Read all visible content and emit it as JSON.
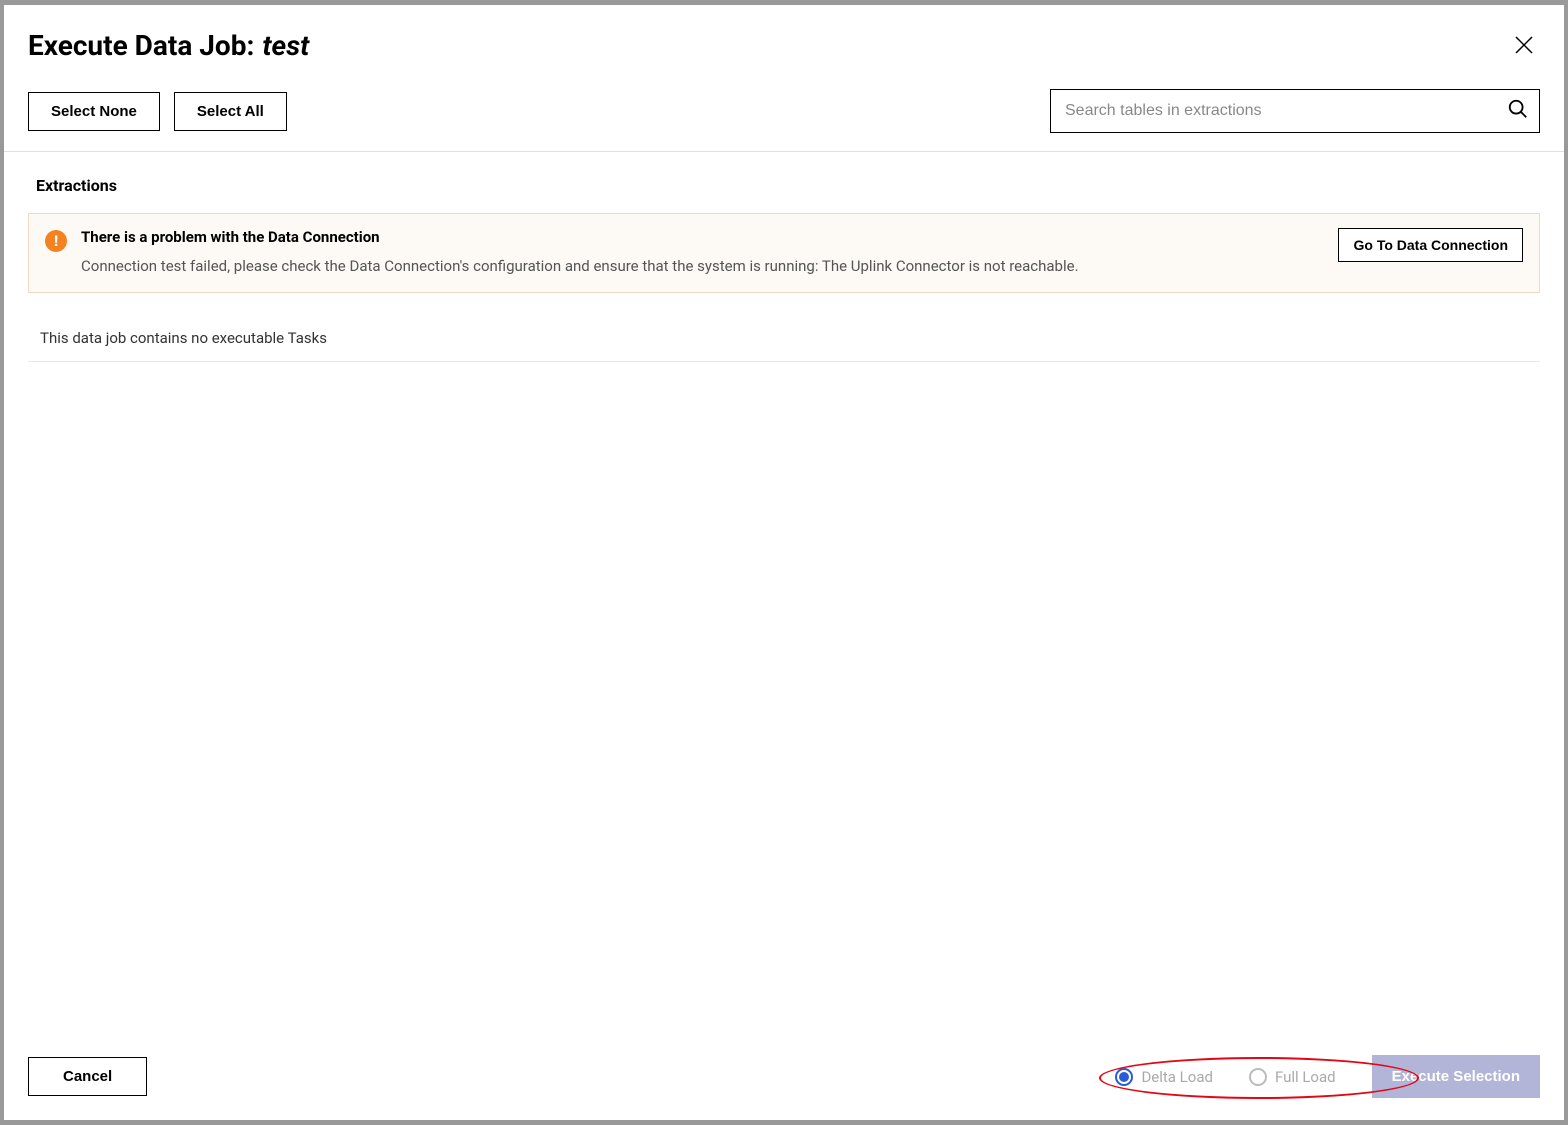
{
  "header": {
    "title_prefix": "Execute Data Job:",
    "job_name": "test"
  },
  "toolbar": {
    "select_none_label": "Select None",
    "select_all_label": "Select All",
    "search_placeholder": "Search tables in extractions"
  },
  "section": {
    "extractions_title": "Extractions"
  },
  "alert": {
    "title": "There is a problem with the Data Connection",
    "message": "Connection test failed, please check the Data Connection's configuration and ensure that the system is running: The Uplink Connector is not reachable.",
    "action_label": "Go To Data Connection"
  },
  "empty_state": "This data job contains no executable Tasks",
  "footer": {
    "cancel_label": "Cancel",
    "delta_load_label": "Delta Load",
    "full_load_label": "Full Load",
    "execute_label": "Execute Selection"
  }
}
